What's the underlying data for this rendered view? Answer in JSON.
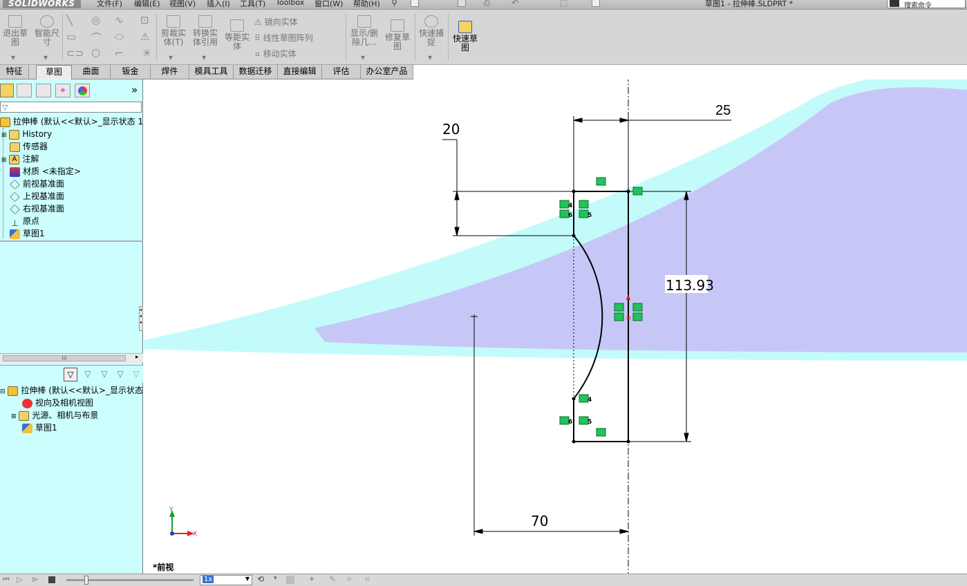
{
  "titlebar": {
    "brand": "SOLIDWORKS",
    "menus": [
      "文件(F)",
      "编辑(E)",
      "视图(V)",
      "插入(I)",
      "工具(T)",
      "Toolbox",
      "窗口(W)",
      "帮助(H)"
    ],
    "document_title": "草图1 - 拉伸棒.SLDPRT *",
    "search_placeholder": "搜索命令"
  },
  "ribbon": {
    "exit_sketch": "退出草\n图",
    "smart_dimension": "智能尺\n寸",
    "trim": "剪裁实\n体(T)",
    "convert": "转换实\n体引用",
    "offset": "等距实\n体",
    "mirror": "镜向实体",
    "linear_pattern": "线性草图阵列",
    "move": "移动实体",
    "display_delete": "显示/删\n除几...",
    "repair": "修复草\n图",
    "quick_snap": "快速捕\n捉",
    "rapid_sketch": "快速草\n图"
  },
  "tabs": [
    "特征",
    "草图",
    "曲面",
    "钣金",
    "焊件",
    "模具工具",
    "数据迁移",
    "直接编辑",
    "评估",
    "办公室产品"
  ],
  "active_tab": "草图",
  "feature_tree": {
    "root": "拉伸棒  (默认<<默认>_显示状态 1",
    "items": [
      "History",
      "传感器",
      "注解",
      "材质 <未指定>",
      "前视基准面",
      "上视基准面",
      "右视基准面",
      "原点",
      "草图1"
    ]
  },
  "display_tree": {
    "root": "拉伸棒  (默认<<默认>_显示状态",
    "items": [
      "视向及相机视图",
      "光源、相机与布景",
      "草图1"
    ]
  },
  "scroll_label": "III",
  "viewport": {
    "dim_25": "25",
    "dim_20": "20",
    "dim_113": "113.93",
    "dim_70": "70",
    "view_label": "*前视",
    "axis_x": "X",
    "axis_y": "Y",
    "relation_tags": [
      "4",
      "6",
      "5",
      "4",
      "6",
      "5"
    ]
  },
  "statusbar": {
    "speed": "1x"
  },
  "colors": {
    "tree_bg": "#ccfefe",
    "ribbon_bg": "#d6d6d6",
    "relation_green": "#22c35a",
    "part_purple": "#c7c7f7",
    "part_cyan": "#c3fbfb"
  }
}
